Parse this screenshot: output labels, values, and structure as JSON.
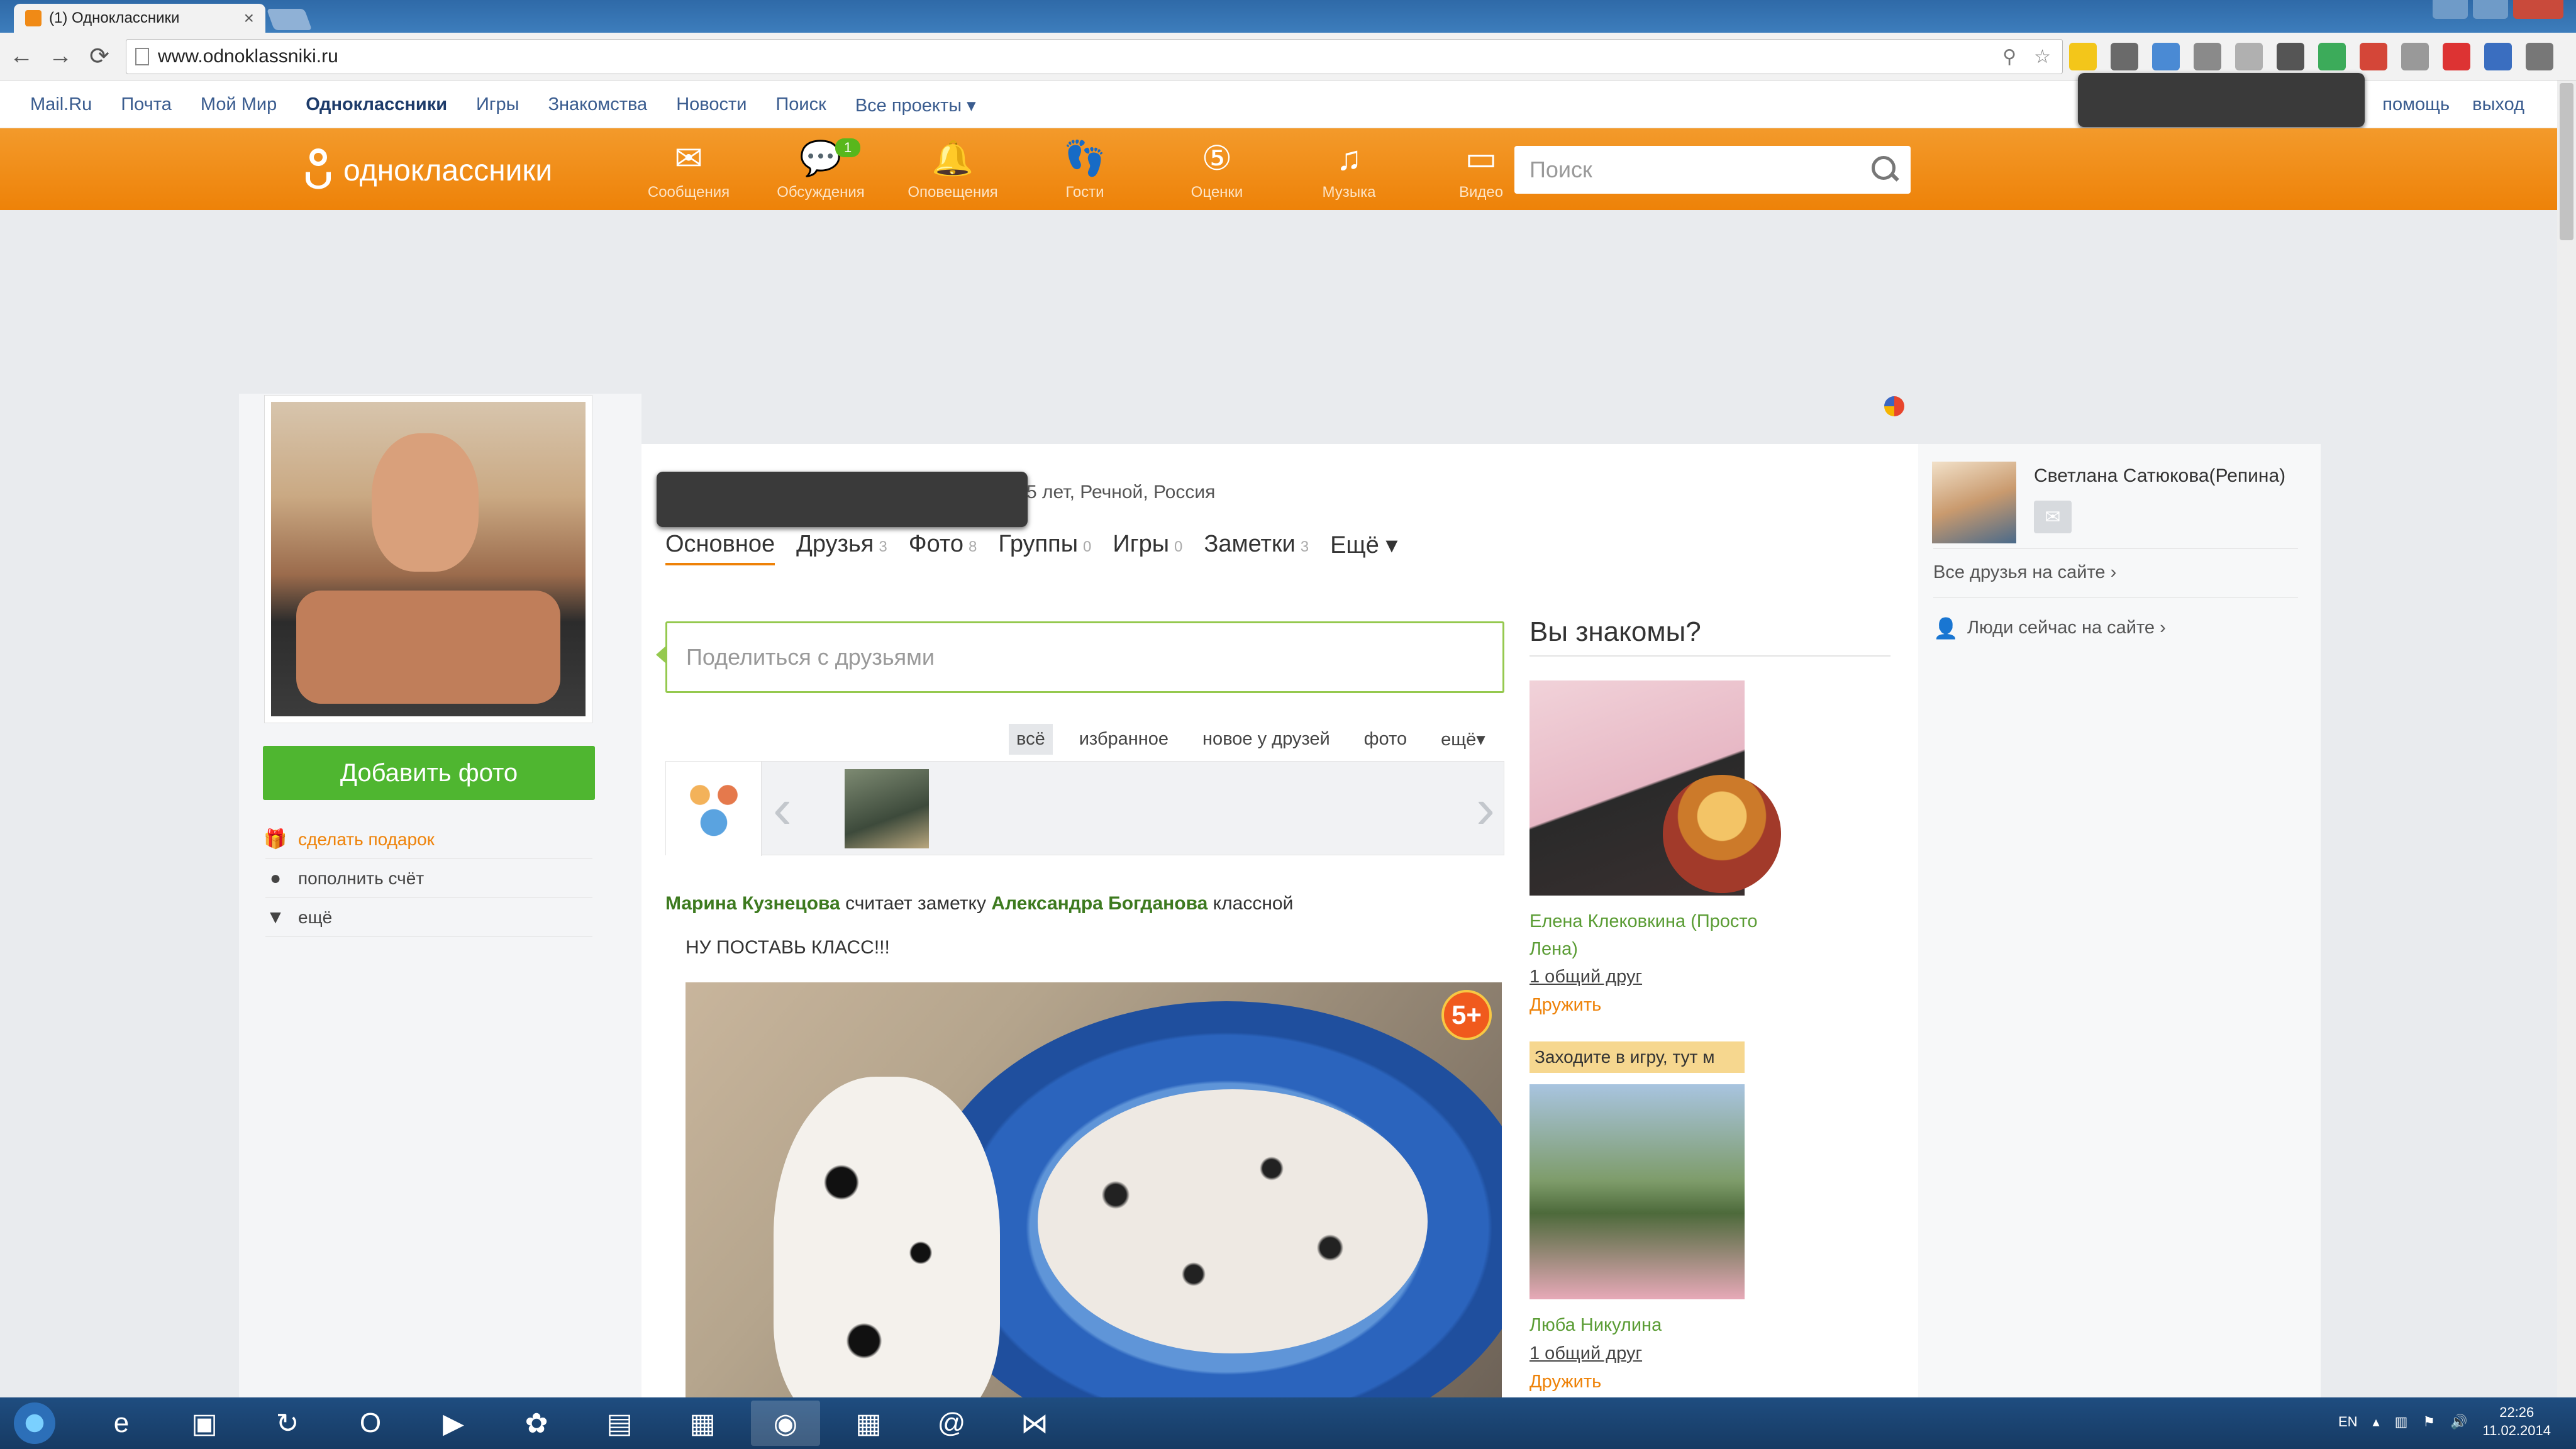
{
  "browser": {
    "tab_title": "(1) Одноклассники",
    "tab_close": "×",
    "url": "www.odnoklassniki.ru",
    "back": "←",
    "forward": "→",
    "reload": "⟳"
  },
  "portal_bar": {
    "links": [
      "Mail.Ru",
      "Почта",
      "Мой Мир",
      "Одноклассники",
      "Игры",
      "Знакомства",
      "Новости",
      "Поиск",
      "Все проекты ▾"
    ],
    "active_index": 3,
    "help": "помощь",
    "logout": "выход"
  },
  "header": {
    "logo_text": "одноклассники",
    "nav": [
      {
        "label": "Сообщения",
        "icon": "envelope-icon",
        "glyph": "✉"
      },
      {
        "label": "Обсуждения",
        "icon": "chat-icon",
        "glyph": "💬",
        "badge": "1"
      },
      {
        "label": "Оповещения",
        "icon": "bell-icon",
        "glyph": "🔔"
      },
      {
        "label": "Гости",
        "icon": "footprints-icon",
        "glyph": "👣"
      },
      {
        "label": "Оценки",
        "icon": "rating-icon",
        "glyph": "⑤"
      },
      {
        "label": "Музыка",
        "icon": "music-icon",
        "glyph": "♫"
      },
      {
        "label": "Видео",
        "icon": "video-icon",
        "glyph": "▭"
      }
    ],
    "search_placeholder": "Поиск"
  },
  "left": {
    "add_photo": "Добавить фото",
    "links": [
      {
        "label": "сделать подарок",
        "icon": "gift-icon",
        "glyph": "🎁"
      },
      {
        "label": "пополнить счёт",
        "icon": "coin-icon",
        "glyph": "●"
      },
      {
        "label": "ещё",
        "icon": "triangle-down-icon",
        "glyph": "▼"
      }
    ]
  },
  "profile": {
    "age_location": "5 лет, Речной, Россия",
    "tabs": [
      {
        "label": "Основное",
        "count": ""
      },
      {
        "label": "Друзья",
        "count": "3"
      },
      {
        "label": "Фото",
        "count": "8"
      },
      {
        "label": "Группы",
        "count": "0"
      },
      {
        "label": "Игры",
        "count": "0"
      },
      {
        "label": "Заметки",
        "count": "3"
      },
      {
        "label": "Ещё ▾",
        "count": ""
      }
    ],
    "share_placeholder": "Поделиться с друзьями",
    "filters": [
      "всё",
      "избранное",
      "новое у друзей",
      "фото",
      "ещё▾"
    ]
  },
  "feed": {
    "actor": "Марина Кузнецова",
    "action": " считает заметку ",
    "author": "Александра Богданова",
    "suffix": " классной",
    "post_text": "НУ ПОСТАВЬ КЛАСС!!!",
    "age_badge": "5+"
  },
  "suggestions": {
    "heading": "Вы знакомы?",
    "people": [
      {
        "name": "Елена Клековкина (Просто Лена)",
        "mutual": "1 общий друг",
        "action": "Дружить"
      },
      {
        "name": "Люба Никулина",
        "mutual": "1 общий друг",
        "action": "Дружить"
      }
    ],
    "promo": "Заходите в игру, тут м"
  },
  "right": {
    "online_friend": "Светлана Сатюкова(Репина)",
    "all_friends": "Все друзья на сайте ›",
    "people_online": "Люди сейчас на сайте ›"
  },
  "taskbar": {
    "lang": "EN",
    "time": "22:26",
    "date": "11.02.2014"
  }
}
